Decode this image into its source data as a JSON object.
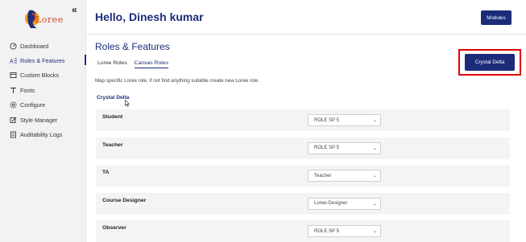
{
  "sidebar": {
    "logo_text": "Loree",
    "items": [
      {
        "label": "Dashboard",
        "icon": "dashboard-icon"
      },
      {
        "label": "Roles & Features",
        "icon": "roles-icon",
        "active": true
      },
      {
        "label": "Custom Blocks",
        "icon": "blocks-icon"
      },
      {
        "label": "Fonts",
        "icon": "fonts-icon"
      },
      {
        "label": "Configure",
        "icon": "configure-icon"
      },
      {
        "label": "Style Manager",
        "icon": "style-manager-icon"
      },
      {
        "label": "Auditability Logs",
        "icon": "logs-icon"
      }
    ]
  },
  "header": {
    "greeting": "Hello, Dinesh kumar",
    "modules_label": "Modules"
  },
  "page": {
    "title": "Roles & Features",
    "tabs": [
      {
        "label": "Loree Roles",
        "active": false
      },
      {
        "label": "Canvas Roles",
        "active": true
      }
    ],
    "crystal_button": "Crystal Delta",
    "description": "Map specific Loree role, if not find anything suitable create new Loree role.",
    "section_label": "Crystal Delta",
    "rows": [
      {
        "label": "Student",
        "value": "ROLE SP 5"
      },
      {
        "label": "Teacher",
        "value": "ROLE SP 5"
      },
      {
        "label": "TA",
        "value": "Teacher"
      },
      {
        "label": "Course Designer",
        "value": "Loree-Designer"
      },
      {
        "label": "Observer",
        "value": "ROLE SP 5"
      }
    ]
  },
  "colors": {
    "brand": "#1c2c7a",
    "highlight": "#e00000",
    "sidebar_bg": "#f2f2f2",
    "row_bg": "#f4f4f4"
  }
}
